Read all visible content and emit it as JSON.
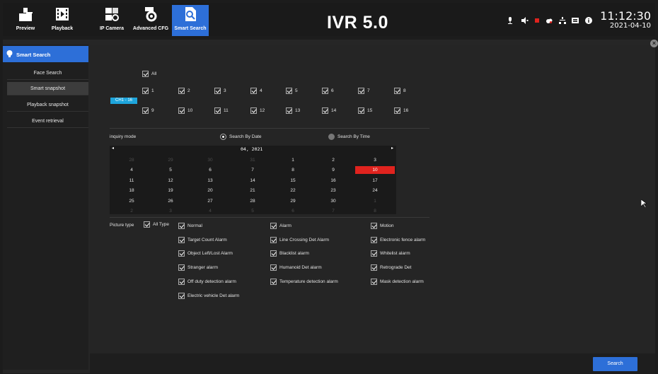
{
  "topbar": {
    "nav": [
      {
        "label": "Preview",
        "icon": "preview-icon"
      },
      {
        "label": "Playback",
        "icon": "playback-icon"
      },
      {
        "label": "IP Camera",
        "icon": "ip-camera-icon"
      },
      {
        "label": "Advanced CFG",
        "icon": "advanced-cfg-icon"
      },
      {
        "label": "Smart Search",
        "icon": "smart-search-icon",
        "active": true
      }
    ],
    "brand": "IVR 5.0",
    "time": "11:12:30",
    "date": "2021-04-10",
    "status_icons": [
      "microphone-icon",
      "speaker-muted-icon",
      "record-icon",
      "cloud-icon",
      "network-icon",
      "storage-icon",
      "info-icon"
    ]
  },
  "sidebar": {
    "header": "Smart Search",
    "items": [
      {
        "label": "Face Search",
        "selected": false
      },
      {
        "label": "Smart snapshot",
        "selected": true
      },
      {
        "label": "Playback snapshot",
        "selected": false
      },
      {
        "label": "Event retrieval",
        "selected": false
      }
    ]
  },
  "channels": {
    "all_label": "All",
    "group_label": "CH1 - 16",
    "row1": [
      "1",
      "2",
      "3",
      "4",
      "5",
      "6",
      "7",
      "8"
    ],
    "row2": [
      "9",
      "10",
      "11",
      "12",
      "13",
      "14",
      "15",
      "16"
    ]
  },
  "inquiry": {
    "label": "inquiry mode",
    "by_date": "Search By Date",
    "by_time": "Search By Time",
    "selected": "by_date"
  },
  "calendar": {
    "prev": "◂",
    "next": "▸",
    "month": "04, 2021",
    "weeks": [
      [
        "28",
        "29",
        "30",
        "31",
        "1",
        "2",
        "3"
      ],
      [
        "4",
        "5",
        "6",
        "7",
        "8",
        "9",
        "10"
      ],
      [
        "11",
        "12",
        "13",
        "14",
        "15",
        "16",
        "17"
      ],
      [
        "18",
        "19",
        "20",
        "21",
        "22",
        "23",
        "24"
      ],
      [
        "25",
        "26",
        "27",
        "28",
        "29",
        "30",
        "1"
      ],
      [
        "2",
        "3",
        "4",
        "5",
        "6",
        "7",
        "8"
      ]
    ],
    "selected_day": "10",
    "today_color": "#e0231e"
  },
  "picture_type": {
    "label": "Picture type",
    "all_label": "All Type",
    "col1": [
      "Normal",
      "Target Count Alarm",
      "Object Left/Lost Alarm",
      "Stranger alarm",
      "Off duty detection alarm",
      "Electric vehicle Det alarm"
    ],
    "col2": [
      "Alarm",
      "Line Crossing Det Alarm",
      "Blacklist alarm",
      "Humanoid Det alarm",
      "Temperature detection alarm"
    ],
    "col3": [
      "Motion",
      "Electronic fence alarm",
      "Whitelist alarm",
      "Retrograde Det",
      "Mask detection alarm"
    ]
  },
  "actions": {
    "search": "Search"
  },
  "colors": {
    "accent": "#2d6fd8",
    "channel_badge": "#1ea5dc"
  }
}
